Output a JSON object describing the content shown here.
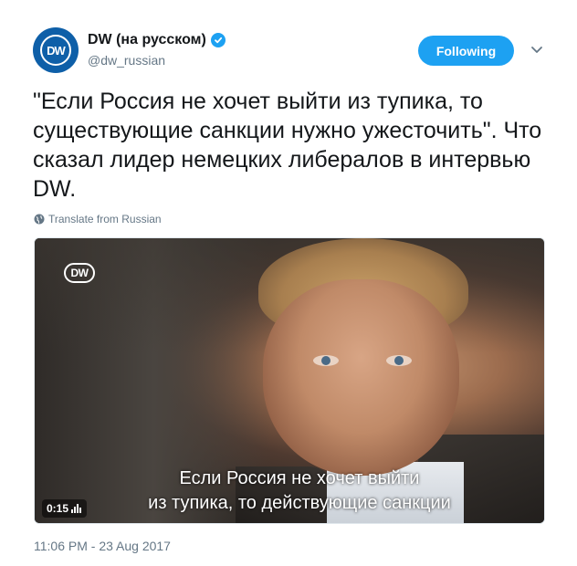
{
  "author": {
    "display_name": "DW (на русском)",
    "handle": "@dw_russian",
    "avatar_text": "DW",
    "verified_icon": "verified-badge-icon"
  },
  "follow_button": {
    "label": "Following"
  },
  "menu": {
    "icon": "chevron-down-icon"
  },
  "tweet": {
    "text": "\"Если Россия не хочет выйти из тупика, то существующие санкции нужно ужесточить\". Что сказал лидер немецких либералов в интервью DW.",
    "translate_label": "Translate from Russian"
  },
  "video": {
    "logo_text": "DW",
    "subtitle_line1": "Если Россия не хочет выйти",
    "subtitle_line2": "из тупика, то действующие санкции",
    "duration": "0:15"
  },
  "timestamp": "11:06 PM - 23 Aug 2017",
  "colors": {
    "accent": "#1da1f2",
    "text_primary": "#14171a",
    "text_secondary": "#657786",
    "dw_blue": "#0e5fa8"
  }
}
